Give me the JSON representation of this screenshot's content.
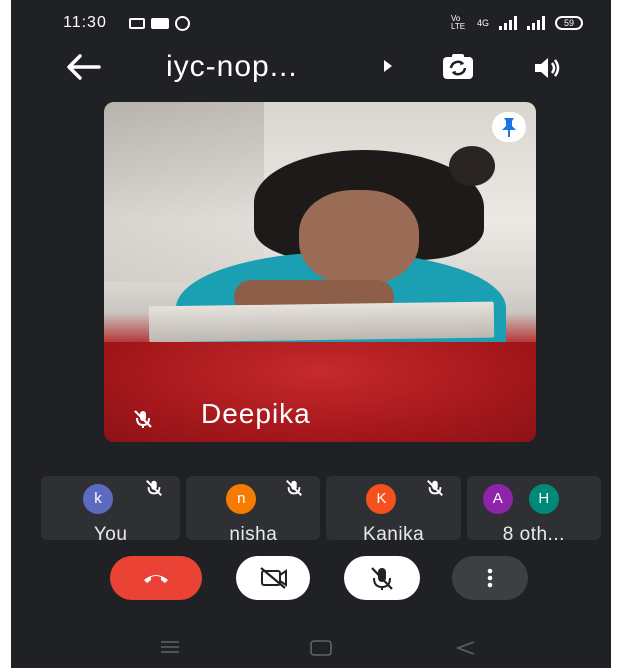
{
  "status_bar": {
    "time": "11:30",
    "volte": "Vo LTE",
    "network": "4G",
    "battery": "59"
  },
  "header": {
    "title": "iyc-nop...",
    "icons": [
      "back-arrow-icon",
      "title-dropdown-icon",
      "switch-camera-icon",
      "speaker-icon"
    ]
  },
  "main_tile": {
    "participant_name": "Deepika",
    "icons": [
      "pin-icon",
      "mic-off-icon"
    ]
  },
  "participants": [
    {
      "name": "You",
      "initial": "k",
      "avatar_color": "#5c6bc0"
    },
    {
      "name": "nisha",
      "initial": "n",
      "avatar_color": "#f57c00"
    },
    {
      "name": "Kanika",
      "initial": "K",
      "avatar_color": "#f4511e"
    },
    {
      "name": "8 oth...",
      "initials": [
        "A",
        "H"
      ],
      "avatar_colors": [
        "#8e24aa",
        "#00897b"
      ]
    }
  ],
  "controls": {
    "icons": [
      "end-call-icon",
      "camera-off-icon",
      "mic-off-icon",
      "more-options-icon"
    ],
    "end_call_color": "#ea4335"
  },
  "navbar": {
    "icons": [
      "recent-apps-icon",
      "home-icon",
      "back-icon"
    ]
  }
}
